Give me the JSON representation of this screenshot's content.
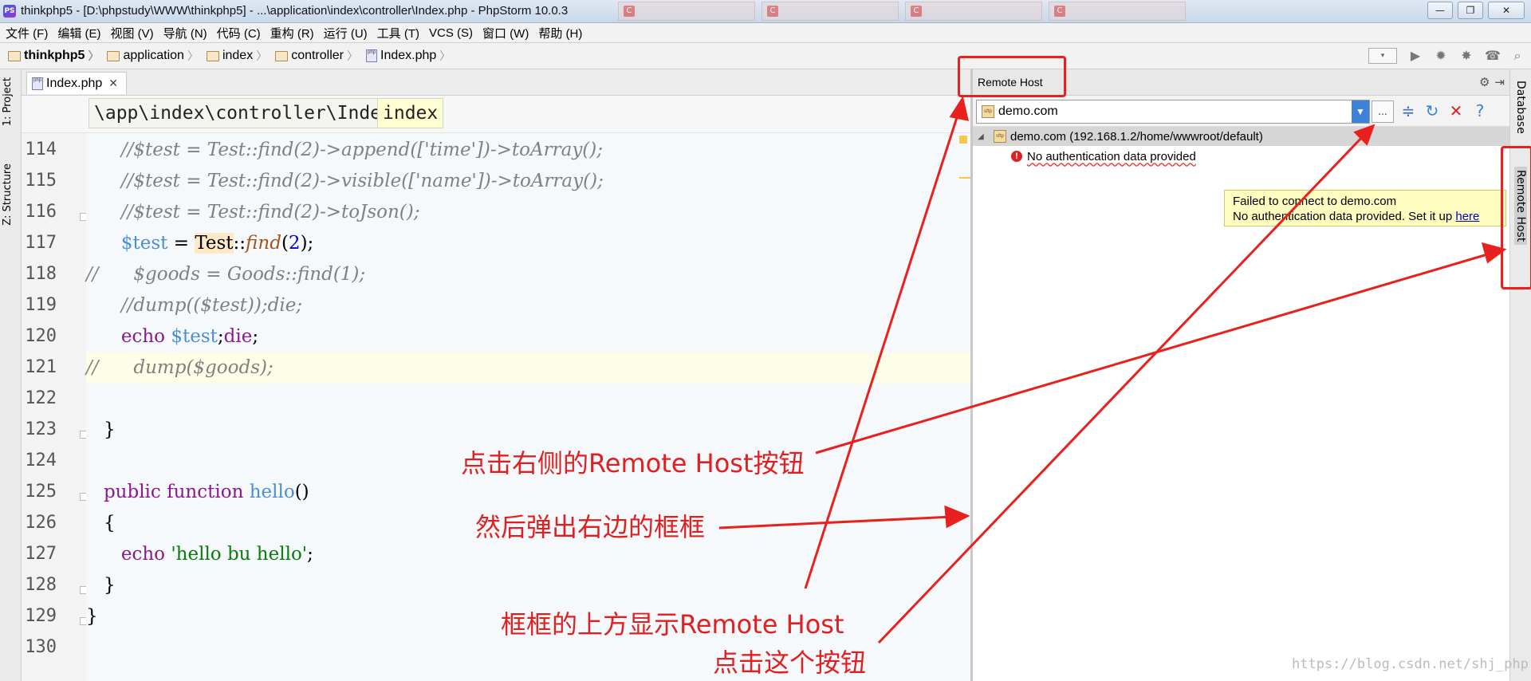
{
  "window": {
    "title": "thinkphp5 - [D:\\phpstudy\\WWW\\thinkphp5] - ...\\application\\index\\controller\\Index.php - PhpStorm 10.0.3",
    "buttons": [
      "—",
      "❐",
      "✕"
    ]
  },
  "menubar": {
    "items": [
      "文件 (F)",
      "编辑 (E)",
      "视图 (V)",
      "导航 (N)",
      "代码 (C)",
      "重构 (R)",
      "运行 (U)",
      "工具 (T)",
      "VCS (S)",
      "窗口 (W)",
      "帮助 (H)"
    ]
  },
  "navbar": {
    "crumbs": [
      "thinkphp5",
      "application",
      "index",
      "controller",
      "Index.php"
    ]
  },
  "left_strip": {
    "tabs": [
      "1: Project",
      "Z: Structure"
    ]
  },
  "editor": {
    "tab_label": "Index.php",
    "breadcrumb": [
      "\\app\\index\\controller\\Index",
      "index"
    ],
    "line_numbers": [
      "114",
      "115",
      "116",
      "117",
      "118",
      "119",
      "120",
      "121",
      "122",
      "123",
      "124",
      "125",
      "126",
      "127",
      "128",
      "129",
      "130"
    ],
    "code": {
      "l114": "//$test = Test::find(2)->append(['time'])->toArray();",
      "l115": "//$test = Test::find(2)->visible(['name'])->toArray();",
      "l116": "//$test = Test::find(2)->toJson();",
      "l117_var": "$test",
      "l117_eq": " = ",
      "l117_cls": "Test",
      "l117_sep": "::",
      "l117_fn": "find",
      "l117_open": "(",
      "l117_num": "2",
      "l117_close": ");",
      "l118_prefix": "//",
      "l118_body": "$goods = Goods::find(1);",
      "l119": "//dump(($test));die;",
      "l120_echo": "echo",
      "l120_var": "$test",
      "l120_semi": ";",
      "l120_die": "die",
      "l120_end": ";",
      "l121_prefix": "//",
      "l121_body": "dump($goods);",
      "l123": "}",
      "l125_public": "public",
      "l125_function": "function",
      "l125_name": "hello",
      "l125_parens": "()",
      "l126": "{",
      "l127_echo": "echo",
      "l127_str": "'hello bu hello'",
      "l127_end": ";",
      "l128": "}",
      "l129": "}"
    }
  },
  "remote_host": {
    "title": "Remote Host",
    "server": "demo.com",
    "more_label": "...",
    "tree_root": "demo.com (192.168.1.2/home/wwwroot/default)",
    "error": "No authentication data provided",
    "tooltip_line1": "Failed to connect to demo.com",
    "tooltip_line2": "No authentication data provided. Set it up ",
    "tooltip_link": "here"
  },
  "right_strip": {
    "tabs": [
      "Database",
      "Remote Host"
    ]
  },
  "annotations": {
    "a1": "点击右侧的Remote Host按钮",
    "a2": "然后弹出右边的框框",
    "a3": "框框的上方显示Remote Host",
    "a4": "点击这个按钮"
  },
  "watermark": "https://blog.csdn.net/shj_php",
  "colors": {
    "annotation_red": "#e02020",
    "combo_blue": "#3b82d8",
    "tooltip_yellow": "#fffdbf"
  }
}
